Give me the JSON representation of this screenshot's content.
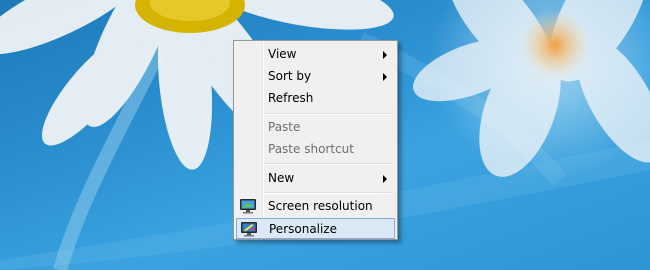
{
  "wallpaper": {
    "description_icon": "daisy-wallpaper"
  },
  "context_menu": {
    "items": [
      {
        "label": "View",
        "submenu": true,
        "enabled": true
      },
      {
        "label": "Sort by",
        "submenu": true,
        "enabled": true
      },
      {
        "label": "Refresh",
        "submenu": false,
        "enabled": true
      },
      {
        "label": "Paste",
        "submenu": false,
        "enabled": false
      },
      {
        "label": "Paste shortcut",
        "submenu": false,
        "enabled": false
      },
      {
        "label": "New",
        "submenu": true,
        "enabled": true
      },
      {
        "label": "Screen resolution",
        "submenu": false,
        "enabled": true,
        "icon": "monitor-icon"
      },
      {
        "label": "Personalize",
        "submenu": false,
        "enabled": true,
        "icon": "personalize-monitor-icon",
        "highlighted": true
      }
    ]
  },
  "colors": {
    "highlight": "#dbe9f6",
    "highlight_border": "#84acdd",
    "wallpaper_blue": "#2b8fd0"
  }
}
